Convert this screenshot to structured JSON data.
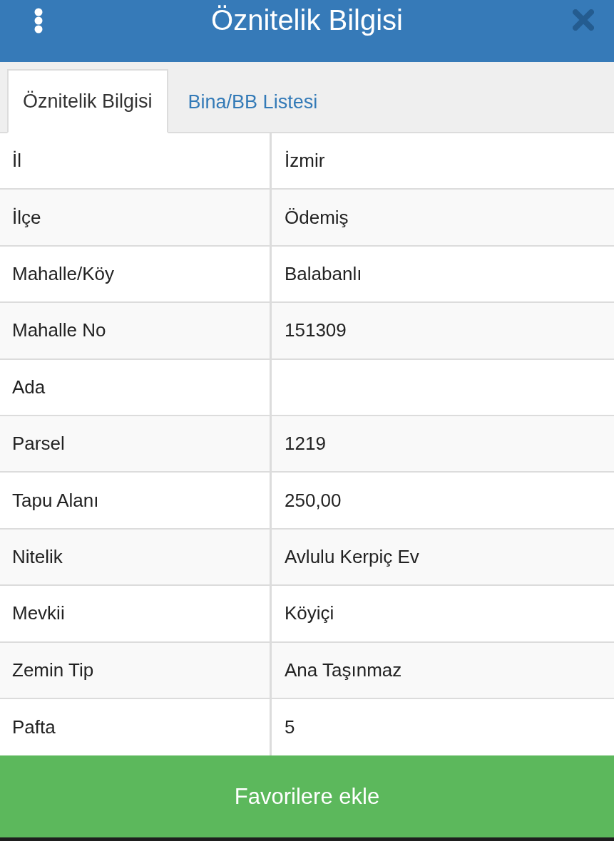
{
  "header": {
    "title": "Öznitelik Bilgisi"
  },
  "tabs": [
    {
      "label": "Öznitelik Bilgisi",
      "selected": true
    },
    {
      "label": "Bina/BB Listesi",
      "selected": false
    }
  ],
  "table": {
    "rows": [
      {
        "label": "İl",
        "value": "İzmir"
      },
      {
        "label": "İlçe",
        "value": "Ödemiş"
      },
      {
        "label": "Mahalle/Köy",
        "value": "Balabanlı"
      },
      {
        "label": "Mahalle No",
        "value": "151309"
      },
      {
        "label": "Ada"
      },
      {
        "label": "Parsel",
        "value": "1219"
      },
      {
        "label": "Tapu Alanı",
        "value": "250,00"
      },
      {
        "label": "Nitelik",
        "value": "Avlulu Kerpiç Ev"
      },
      {
        "label": "Mevkii",
        "value": "Köyiçi"
      },
      {
        "label": "Zemin Tip",
        "value": "Ana Taşınmaz"
      },
      {
        "label": "Pafta",
        "value": "5"
      }
    ]
  },
  "button": {
    "label": "Favorilere ekle"
  }
}
